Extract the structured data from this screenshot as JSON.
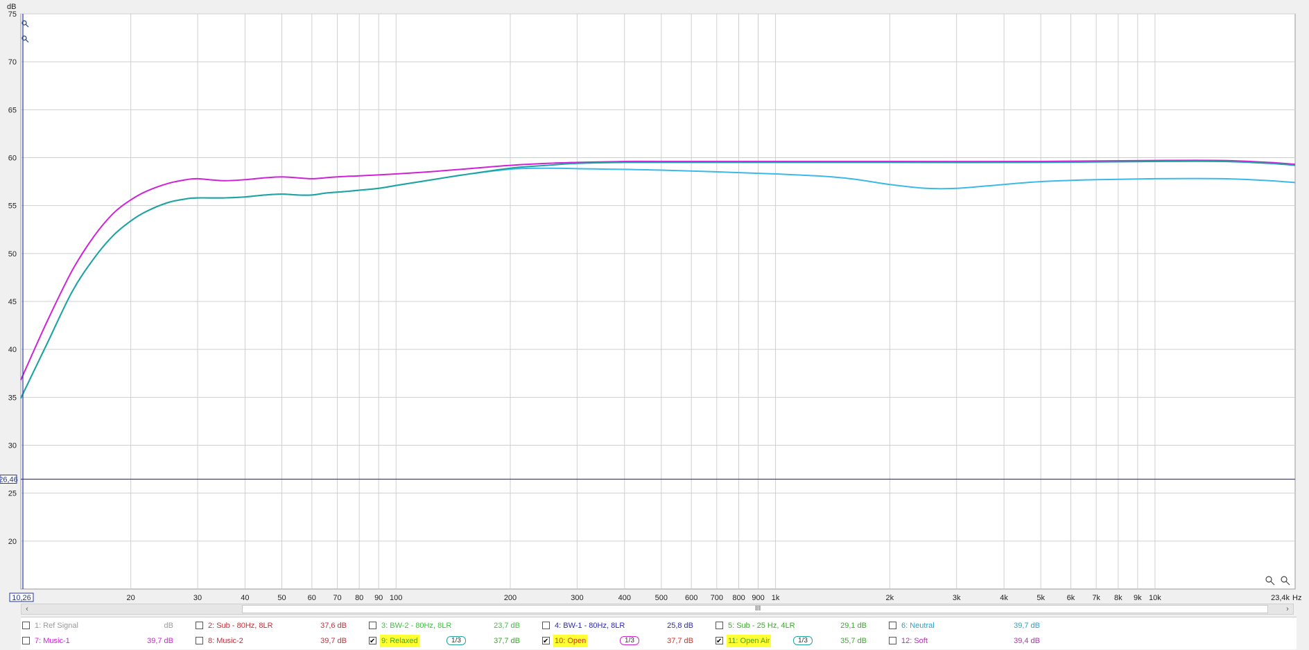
{
  "chart_data": {
    "type": "line",
    "ylabel": "dB",
    "xunit": "Hz",
    "xscale": "log",
    "xlim": [
      10.26,
      23400
    ],
    "ylim": [
      15,
      75
    ],
    "y_ticks": [
      "20",
      "25",
      "30",
      "35",
      "40",
      "45",
      "50",
      "55",
      "60",
      "65",
      "70",
      "75"
    ],
    "x_ticks": [
      {
        "v": 20,
        "l": "20"
      },
      {
        "v": 30,
        "l": "30"
      },
      {
        "v": 40,
        "l": "40"
      },
      {
        "v": 50,
        "l": "50"
      },
      {
        "v": 60,
        "l": "60"
      },
      {
        "v": 70,
        "l": "70"
      },
      {
        "v": 80,
        "l": "80"
      },
      {
        "v": 90,
        "l": "90"
      },
      {
        "v": 100,
        "l": "100"
      },
      {
        "v": 200,
        "l": "200"
      },
      {
        "v": 300,
        "l": "300"
      },
      {
        "v": 400,
        "l": "400"
      },
      {
        "v": 500,
        "l": "500"
      },
      {
        "v": 600,
        "l": "600"
      },
      {
        "v": 700,
        "l": "700"
      },
      {
        "v": 800,
        "l": "800"
      },
      {
        "v": 900,
        "l": "900"
      },
      {
        "v": 1000,
        "l": "1k"
      },
      {
        "v": 2000,
        "l": "2k"
      },
      {
        "v": 3000,
        "l": "3k"
      },
      {
        "v": 4000,
        "l": "4k"
      },
      {
        "v": 5000,
        "l": "5k"
      },
      {
        "v": 6000,
        "l": "6k"
      },
      {
        "v": 7000,
        "l": "7k"
      },
      {
        "v": 8000,
        "l": "8k"
      },
      {
        "v": 9000,
        "l": "9k"
      },
      {
        "v": 10000,
        "l": "10k"
      }
    ],
    "x_start_label": "10,26",
    "x_end_label": "23,4k",
    "cursor_y_label": "26,46",
    "cursor_y_value": 26.46,
    "grid": true,
    "series": [
      {
        "name": "10: Open",
        "color": "#d020d8",
        "points": [
          [
            10.26,
            36.8
          ],
          [
            12,
            42.8
          ],
          [
            14,
            48.2
          ],
          [
            16,
            51.8
          ],
          [
            18,
            54.2
          ],
          [
            20,
            55.6
          ],
          [
            22,
            56.5
          ],
          [
            25,
            57.3
          ],
          [
            28,
            57.7
          ],
          [
            30,
            57.8
          ],
          [
            35,
            57.6
          ],
          [
            40,
            57.7
          ],
          [
            45,
            57.9
          ],
          [
            50,
            58.0
          ],
          [
            55,
            57.9
          ],
          [
            60,
            57.8
          ],
          [
            65,
            57.9
          ],
          [
            70,
            58.0
          ],
          [
            80,
            58.1
          ],
          [
            90,
            58.2
          ],
          [
            100,
            58.3
          ],
          [
            120,
            58.5
          ],
          [
            150,
            58.8
          ],
          [
            200,
            59.2
          ],
          [
            250,
            59.4
          ],
          [
            300,
            59.5
          ],
          [
            400,
            59.6
          ],
          [
            500,
            59.6
          ],
          [
            1000,
            59.6
          ],
          [
            2000,
            59.6
          ],
          [
            5000,
            59.6
          ],
          [
            10000,
            59.7
          ],
          [
            15000,
            59.7
          ],
          [
            20000,
            59.5
          ],
          [
            23400,
            59.3
          ]
        ]
      },
      {
        "name": "9: Relaxed",
        "color": "#3ab8e8",
        "points": [
          [
            10.26,
            34.9
          ],
          [
            12,
            40.5
          ],
          [
            14,
            46.0
          ],
          [
            16,
            49.5
          ],
          [
            18,
            51.9
          ],
          [
            20,
            53.4
          ],
          [
            22,
            54.4
          ],
          [
            25,
            55.3
          ],
          [
            28,
            55.7
          ],
          [
            30,
            55.8
          ],
          [
            35,
            55.8
          ],
          [
            40,
            55.9
          ],
          [
            45,
            56.1
          ],
          [
            50,
            56.2
          ],
          [
            55,
            56.1
          ],
          [
            60,
            56.1
          ],
          [
            65,
            56.3
          ],
          [
            70,
            56.4
          ],
          [
            80,
            56.6
          ],
          [
            90,
            56.8
          ],
          [
            100,
            57.1
          ],
          [
            120,
            57.6
          ],
          [
            150,
            58.2
          ],
          [
            200,
            58.8
          ],
          [
            250,
            58.9
          ],
          [
            300,
            58.85
          ],
          [
            500,
            58.7
          ],
          [
            1000,
            58.3
          ],
          [
            1500,
            57.9
          ],
          [
            2000,
            57.2
          ],
          [
            2500,
            56.8
          ],
          [
            3000,
            56.8
          ],
          [
            4000,
            57.2
          ],
          [
            5000,
            57.5
          ],
          [
            7000,
            57.7
          ],
          [
            10000,
            57.8
          ],
          [
            15000,
            57.8
          ],
          [
            20000,
            57.6
          ],
          [
            23400,
            57.4
          ]
        ]
      },
      {
        "name": "11: Open Air",
        "color": "#1fa3a0",
        "points": [
          [
            10.26,
            34.9
          ],
          [
            12,
            40.5
          ],
          [
            14,
            46.0
          ],
          [
            16,
            49.5
          ],
          [
            18,
            51.9
          ],
          [
            20,
            53.4
          ],
          [
            22,
            54.4
          ],
          [
            25,
            55.3
          ],
          [
            28,
            55.7
          ],
          [
            30,
            55.8
          ],
          [
            35,
            55.8
          ],
          [
            40,
            55.9
          ],
          [
            45,
            56.1
          ],
          [
            50,
            56.2
          ],
          [
            55,
            56.1
          ],
          [
            60,
            56.1
          ],
          [
            65,
            56.3
          ],
          [
            70,
            56.4
          ],
          [
            80,
            56.6
          ],
          [
            90,
            56.8
          ],
          [
            100,
            57.1
          ],
          [
            120,
            57.6
          ],
          [
            150,
            58.2
          ],
          [
            200,
            58.9
          ],
          [
            250,
            59.2
          ],
          [
            300,
            59.4
          ],
          [
            400,
            59.5
          ],
          [
            500,
            59.5
          ],
          [
            1000,
            59.5
          ],
          [
            2000,
            59.5
          ],
          [
            5000,
            59.5
          ],
          [
            10000,
            59.6
          ],
          [
            15000,
            59.6
          ],
          [
            20000,
            59.4
          ],
          [
            23400,
            59.2
          ]
        ]
      }
    ]
  },
  "legend": {
    "row1": [
      {
        "name": "1: Ref Signal",
        "value": "dB",
        "checked": false,
        "color": "#999999",
        "hl": false
      },
      {
        "name": "2: Sub - 80Hz, 8LR",
        "value": "37,6 dB",
        "checked": false,
        "color": "#c0303a",
        "hl": false
      },
      {
        "name": "3: BW-2 - 80Hz, 8LR",
        "value": "23,7 dB",
        "checked": false,
        "color": "#3fbf3f",
        "hl": false
      },
      {
        "name": "4: BW-1 - 80Hz, 8LR",
        "value": "25,8 dB",
        "checked": false,
        "color": "#2a2ab0",
        "hl": false
      },
      {
        "name": "5: Sub - 25 Hz, 4LR",
        "value": "29,1 dB",
        "checked": false,
        "color": "#3aa82a",
        "hl": false
      },
      {
        "name": "6: Neutral",
        "value": "39,7 dB",
        "checked": false,
        "color": "#2aa0c8",
        "hl": false
      }
    ],
    "row2": [
      {
        "name": "7: Music-1",
        "value": "39,7 dB",
        "checked": false,
        "color": "#d020d8",
        "hl": false
      },
      {
        "name": "8: Music-2",
        "value": "39,7 dB",
        "checked": false,
        "color": "#c0303a",
        "hl": false
      },
      {
        "name": "9: Relaxed",
        "value": "37,7 dB",
        "checked": true,
        "color": "#3aa82a",
        "hl": true,
        "smooth": "1/3",
        "smooth_color": "#1fa3a0"
      },
      {
        "name": "10: Open",
        "value": "37,7 dB",
        "checked": true,
        "color": "#d03020",
        "hl": true,
        "smooth": "1/3",
        "smooth_color": "#d020d8"
      },
      {
        "name": "11: Open Air",
        "value": "35,7 dB",
        "checked": true,
        "color": "#3aa82a",
        "hl": true,
        "smooth": "1/3",
        "smooth_color": "#1fa3a0"
      },
      {
        "name": "12: Soft",
        "value": "39,4 dB",
        "checked": false,
        "color": "#b030b0",
        "hl": false
      }
    ]
  },
  "scroll": {
    "left_arrow": "‹",
    "right_arrow": "›",
    "grip": "III"
  },
  "icons": {
    "zoom": "magnifier-icon"
  }
}
